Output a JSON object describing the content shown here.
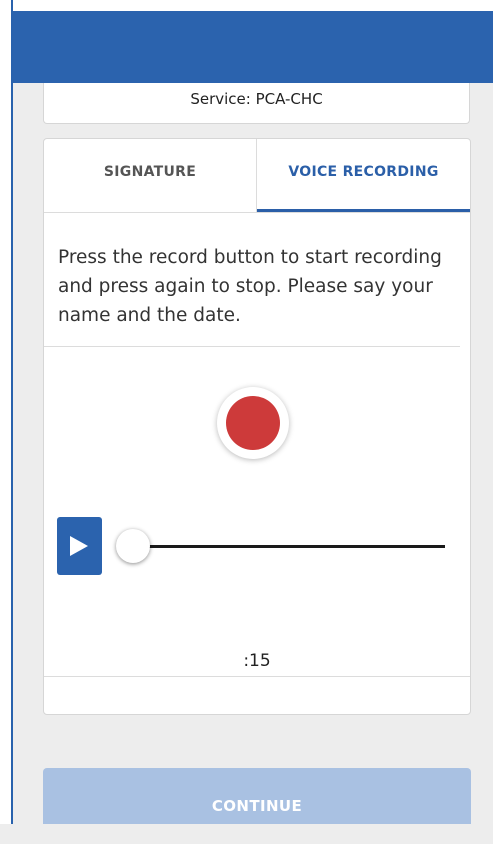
{
  "service": {
    "label": "Service: PCA-CHC"
  },
  "tabs": [
    {
      "label": "SIGNATURE",
      "active": false
    },
    {
      "label": "VOICE RECORDING",
      "active": true
    }
  ],
  "recording": {
    "instructions": "Press the record button to start recording and press again to stop. Please say your name and the date.",
    "timer": ":15",
    "playback_position": 0
  },
  "footer": {
    "continue_label": "CONTINUE",
    "continue_enabled": false
  },
  "colors": {
    "primary": "#2b63ae",
    "record": "#cd3a3a",
    "disabled_button": "#a9c1e2",
    "background": "#ededed"
  },
  "icons": {
    "play": "play-icon",
    "record": "record-icon"
  }
}
